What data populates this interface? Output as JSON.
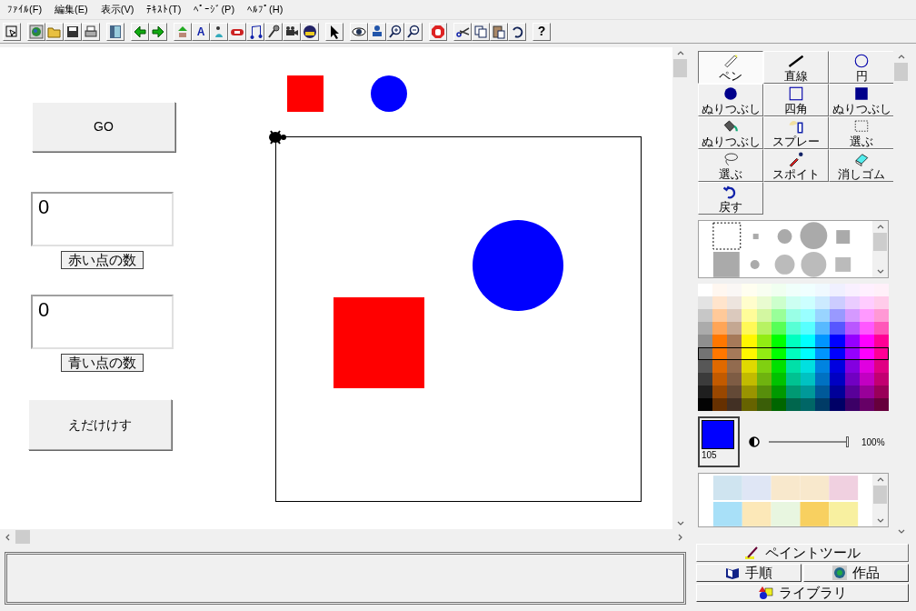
{
  "menu": [
    "ﾌｧｲﾙ(F)",
    "編集(E)",
    "表示(V)",
    "ﾃｷｽﾄ(T)",
    "ﾍﾟｰｼﾞ(P)",
    "ﾍﾙﾌﾟ(H)"
  ],
  "toolbar": {
    "text_label": "A",
    "help_label": "?"
  },
  "stage": {
    "items": [
      {
        "kind": "button",
        "label": "GO"
      },
      {
        "kind": "field",
        "value": "0"
      },
      {
        "kind": "label",
        "text": "赤い点の数"
      },
      {
        "kind": "field",
        "value": "0"
      },
      {
        "kind": "label",
        "text": "青い点の数"
      },
      {
        "kind": "button",
        "label": "えだけけす"
      }
    ]
  },
  "paint_tools": [
    {
      "kind": "pen",
      "label": "ペン",
      "selected": true
    },
    {
      "kind": "line",
      "label": "直線",
      "selected": false
    },
    {
      "kind": "circle",
      "label": "円",
      "selected": false
    },
    {
      "kind": "filled-circle",
      "label": "ぬりつぶし",
      "selected": false
    },
    {
      "kind": "rect",
      "label": "四角",
      "selected": false
    },
    {
      "kind": "filled-rect",
      "label": "ぬりつぶし",
      "selected": false
    },
    {
      "kind": "bucket",
      "label": "ぬりつぶし",
      "selected": false
    },
    {
      "kind": "spray",
      "label": "スプレー",
      "selected": false
    },
    {
      "kind": "rect-select",
      "label": "選ぶ",
      "selected": false
    },
    {
      "kind": "lasso",
      "label": "選ぶ",
      "selected": false
    },
    {
      "kind": "dropper",
      "label": "スポイト",
      "selected": false
    },
    {
      "kind": "eraser",
      "label": "消しゴム",
      "selected": false
    },
    {
      "kind": "undo",
      "label": "戻す",
      "selected": false
    }
  ],
  "palette": {
    "rows": [
      {
        "selected": false
      },
      {
        "selected": false
      },
      {
        "selected": false
      },
      {
        "selected": false
      },
      {
        "selected": false
      },
      {
        "selected": true
      },
      {
        "selected": false
      },
      {
        "selected": false
      },
      {
        "selected": false
      },
      {
        "selected": false
      }
    ]
  },
  "current_color": {
    "color": "#0000ff",
    "label": "105"
  },
  "opacity": {
    "level": 1,
    "reading": "100%"
  },
  "tabs": [
    {
      "label": "ペイントツール",
      "selected": true
    },
    {
      "label": "手順",
      "selected": false
    },
    {
      "label": "作品",
      "selected": false
    },
    {
      "label": "ライブラリ",
      "selected": false
    }
  ]
}
